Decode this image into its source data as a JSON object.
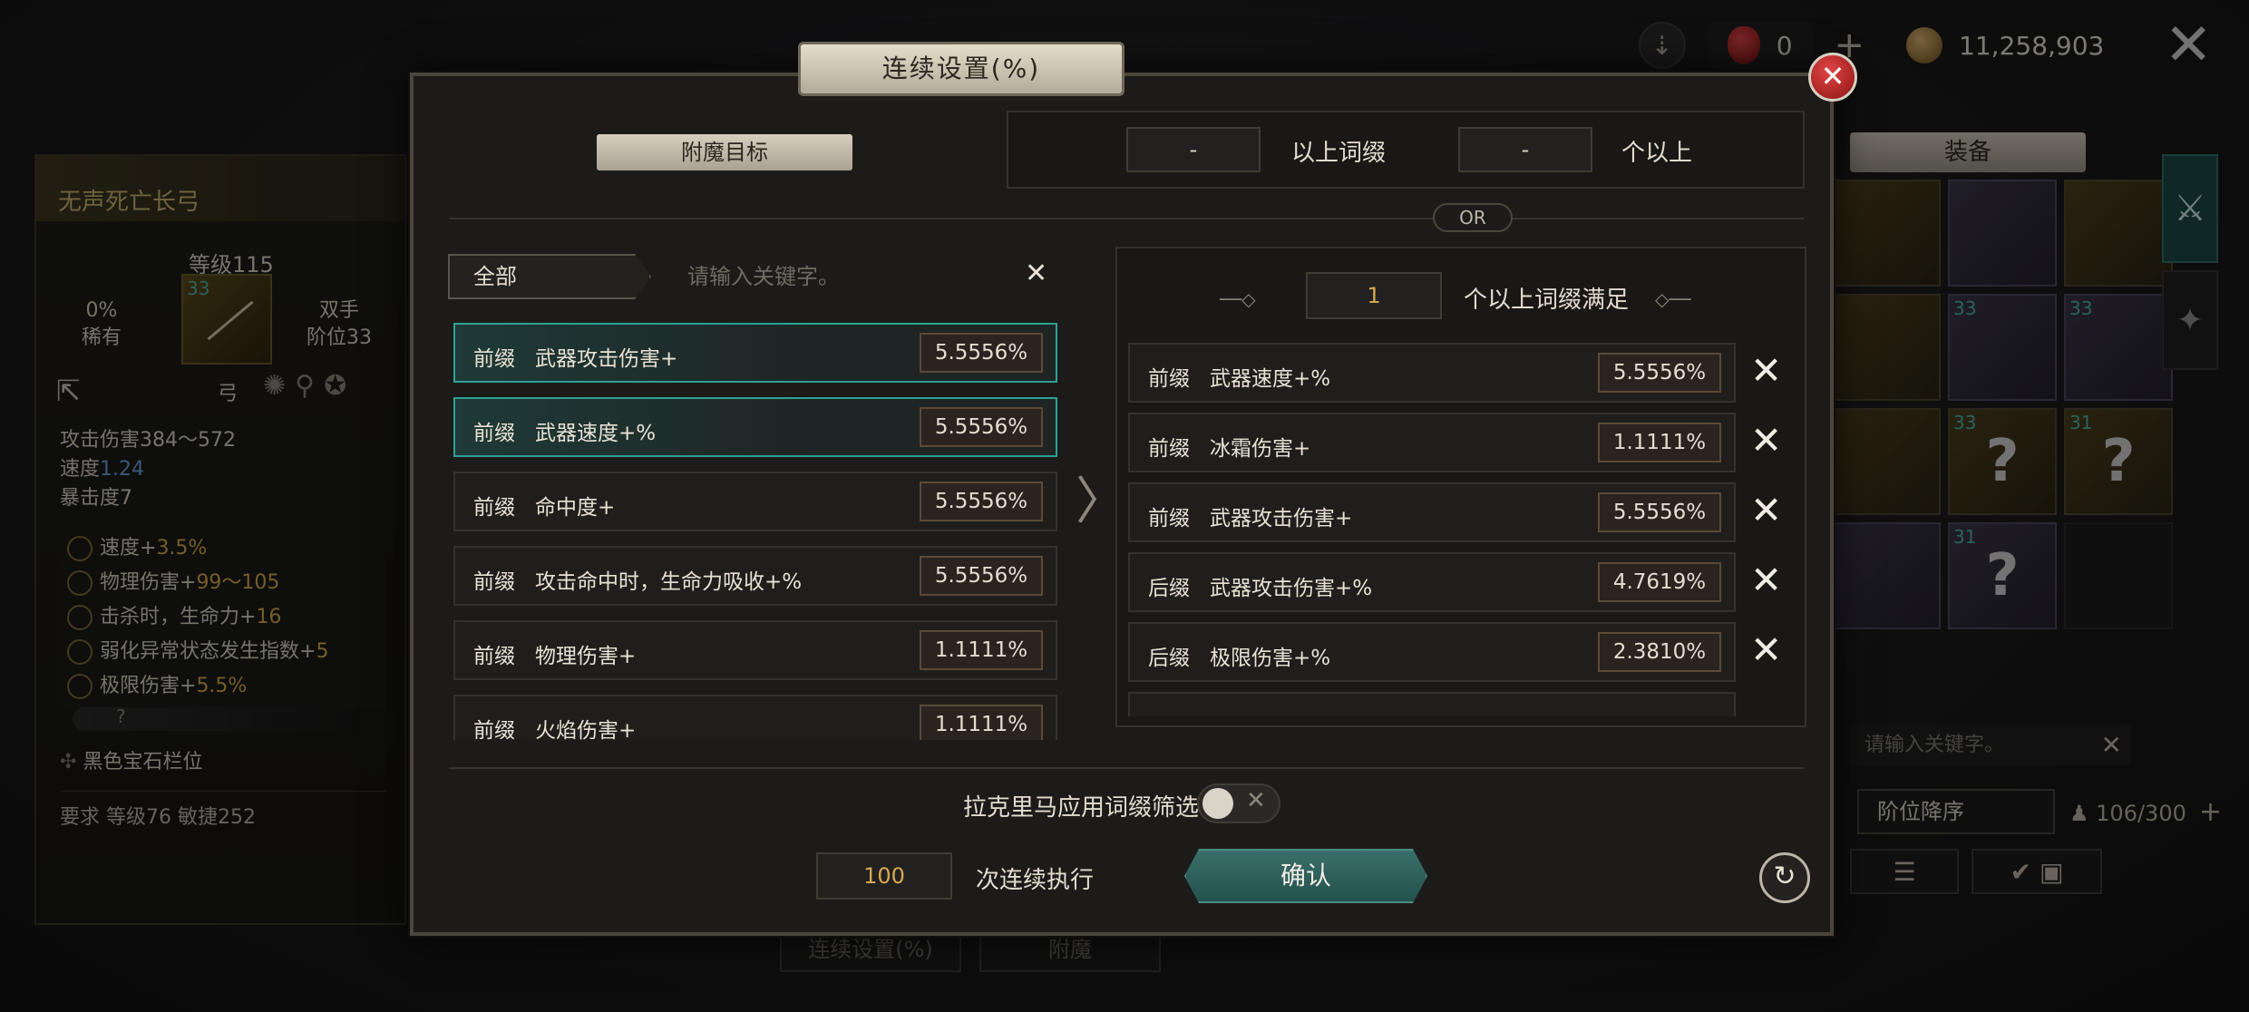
{
  "topbar": {
    "gem_count": "0",
    "gold_count": "11,258,903"
  },
  "item": {
    "name": "无声死亡长弓",
    "level": "等级115",
    "rarity_pct": "0%",
    "rarity": "稀有",
    "hands": "双手",
    "tier": "阶位33",
    "thumb_num": "33",
    "type": "弓",
    "attack": "攻击伤害384～572",
    "speed_label": "速度",
    "speed_value": "1.24",
    "crit": "暴击度7",
    "affixes": [
      {
        "text": "速度+",
        "value": "3.5%"
      },
      {
        "text": "物理伤害+",
        "value": "99～105"
      },
      {
        "text": "击杀时，生命力+",
        "value": "16"
      },
      {
        "text": "弱化异常状态发生指数+",
        "value": "5"
      },
      {
        "text": "极限伤害+",
        "value": "5.5%"
      }
    ],
    "socket_mark": "?",
    "gem_slot": "黑色宝石栏位",
    "requirement": "要求 等级76 敏捷252"
  },
  "equipment": {
    "title": "装备",
    "search_placeholder": "请输入关键字。",
    "sort": "阶位降序",
    "capacity": "106/300",
    "cells": [
      {
        "num": "",
        "q": "",
        "style": "gold"
      },
      {
        "num": "",
        "q": "",
        "style": "purple"
      },
      {
        "num": "",
        "q": "",
        "style": "gold"
      },
      {
        "num": "",
        "q": "",
        "style": "gold"
      },
      {
        "num": "33",
        "q": "",
        "style": "purple"
      },
      {
        "num": "33",
        "q": "",
        "style": "purple"
      },
      {
        "num": "",
        "q": "",
        "style": "gold"
      },
      {
        "num": "33",
        "q": "?",
        "style": "gold"
      },
      {
        "num": "31",
        "q": "?",
        "style": "gold"
      },
      {
        "num": "",
        "q": "",
        "style": "purple"
      },
      {
        "num": "31",
        "q": "?",
        "style": "purple"
      },
      {
        "num": "",
        "q": "",
        "style": "empty"
      }
    ]
  },
  "bottom_tabs": [
    "连续设置(%)",
    "附魔"
  ],
  "modal": {
    "title": "连续设置(%)",
    "target_label": "附魔目标",
    "cond_input_1": "-",
    "cond_text_1": "以上词缀",
    "cond_input_2": "-",
    "cond_text_2": "个以上",
    "or_label": "OR",
    "category": "全部",
    "keyword_placeholder": "请输入关键字。",
    "left_rows": [
      {
        "type": "前缀",
        "name": "武器攻击伤害+",
        "pct": "5.5556%",
        "selected": true
      },
      {
        "type": "前缀",
        "name": "武器速度+%",
        "pct": "5.5556%",
        "selected": true
      },
      {
        "type": "前缀",
        "name": "命中度+",
        "pct": "5.5556%",
        "selected": false
      },
      {
        "type": "前缀",
        "name": "攻击命中时，生命力吸收+%",
        "pct": "5.5556%",
        "selected": false
      },
      {
        "type": "前缀",
        "name": "物理伤害+",
        "pct": "1.1111%",
        "selected": false
      },
      {
        "type": "前缀",
        "name": "火焰伤害+",
        "pct": "1.1111%",
        "selected": false
      }
    ],
    "satisfy_input": "1",
    "satisfy_text": "个以上词缀满足",
    "right_rows": [
      {
        "type": "前缀",
        "name": "武器速度+%",
        "pct": "5.5556%"
      },
      {
        "type": "前缀",
        "name": "冰霜伤害+",
        "pct": "1.1111%"
      },
      {
        "type": "前缀",
        "name": "武器攻击伤害+",
        "pct": "5.5556%"
      },
      {
        "type": "后缀",
        "name": "武器攻击伤害+%",
        "pct": "4.7619%"
      },
      {
        "type": "后缀",
        "name": "极限伤害+%",
        "pct": "2.3810%"
      }
    ],
    "rakrima_label": "拉克里马应用词缀筛选",
    "count": "100",
    "count_label": "次连续执行",
    "confirm": "确认"
  },
  "colors": {
    "accent_teal": "#2da294",
    "gold_text": "#d8a94f",
    "close_red": "#c62828"
  }
}
